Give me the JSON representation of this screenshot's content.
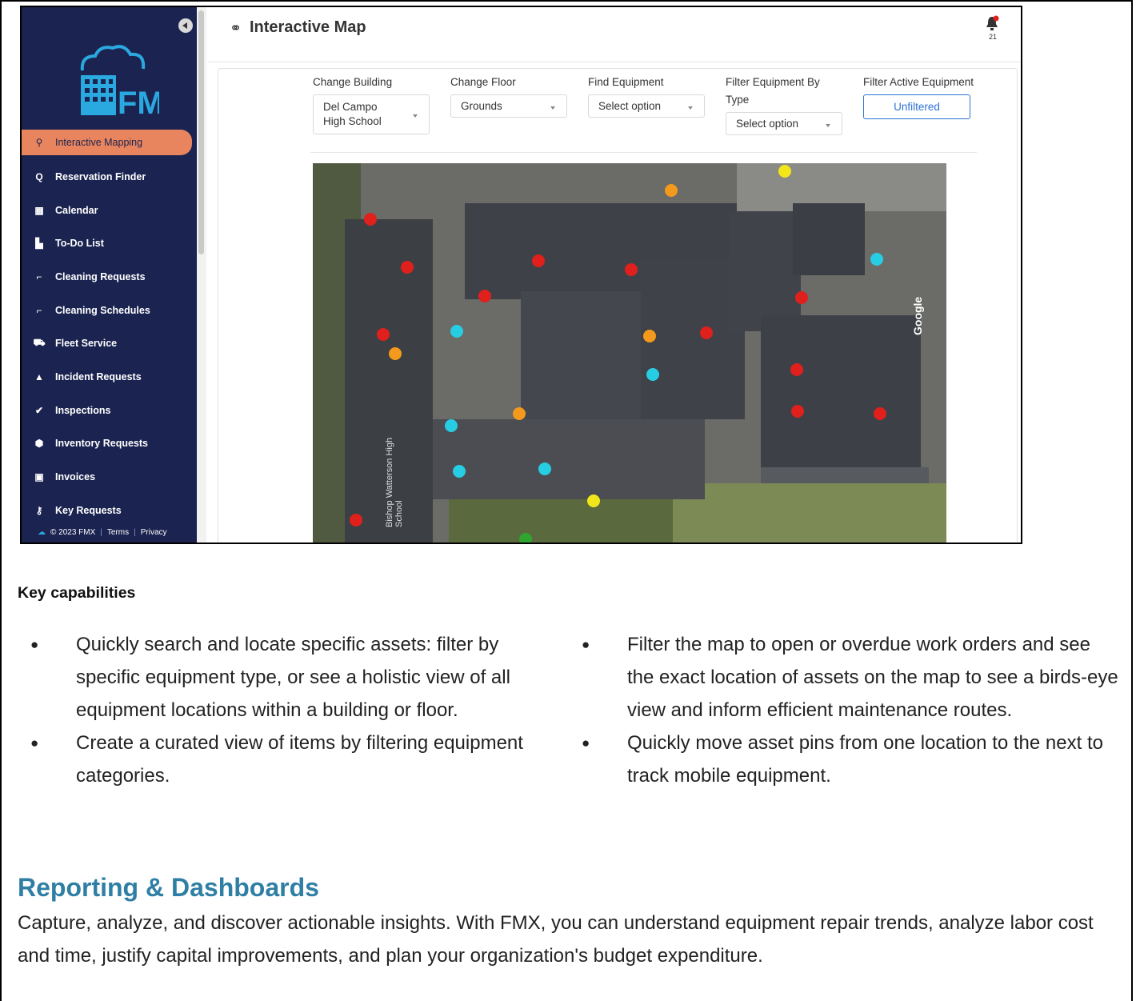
{
  "screenshot": {
    "sidebar": {
      "nav_items": [
        {
          "label": "Interactive Mapping",
          "icon": "map-pin-icon",
          "glyph": "📍"
        },
        {
          "label": "Reservation Finder",
          "icon": "search-icon",
          "glyph": "Q"
        },
        {
          "label": "Calendar",
          "icon": "calendar-icon",
          "glyph": "▦"
        },
        {
          "label": "To-Do List",
          "icon": "clipboard-icon",
          "glyph": "▙"
        },
        {
          "label": "Cleaning Requests",
          "icon": "spray-icon",
          "glyph": "⌐"
        },
        {
          "label": "Cleaning Schedules",
          "icon": "spray-icon",
          "glyph": "⌐"
        },
        {
          "label": "Fleet Service",
          "icon": "car-icon",
          "glyph": "⛟"
        },
        {
          "label": "Incident Requests",
          "icon": "warning-icon",
          "glyph": "▲"
        },
        {
          "label": "Inspections",
          "icon": "check-icon",
          "glyph": "✔"
        },
        {
          "label": "Inventory Requests",
          "icon": "box-icon",
          "glyph": "⬢"
        },
        {
          "label": "Invoices",
          "icon": "money-icon",
          "glyph": "▣"
        },
        {
          "label": "Key Requests",
          "icon": "key-icon",
          "glyph": "⚷"
        }
      ],
      "footer": {
        "copyright": "© 2023 FMX",
        "terms": "Terms",
        "privacy": "Privacy"
      }
    },
    "header": {
      "title": "Interactive Map",
      "notification_count": "21"
    },
    "filters": {
      "building": {
        "label": "Change Building",
        "value": "Del Campo High School"
      },
      "floor": {
        "label": "Change Floor",
        "value": "Grounds"
      },
      "equipment": {
        "label": "Find Equipment",
        "value": "Select option"
      },
      "type": {
        "label": "Filter Equipment By Type",
        "value": "Select option"
      },
      "active": {
        "label": "Filter Active Equipment",
        "value": "Unfiltered"
      }
    },
    "map": {
      "watermark": "Google",
      "street_label": "Bishop Watterson High School",
      "pin_colors": {
        "red": "#e0201c",
        "cyan": "#27cde3",
        "orange": "#f39a1c",
        "yellow": "#f2e61b",
        "green": "#2fa52f"
      }
    }
  },
  "key_capabilities": {
    "title": "Key capabilities",
    "left": [
      "Quickly search and locate specific assets: filter by specific equipment type, or see a holistic view of all equipment locations within a building or floor.",
      "Create a curated view of items by filtering equipment categories."
    ],
    "right": [
      "Filter the map to open or overdue work orders and see the exact location of assets on the map to see a birds-eye view and inform efficient maintenance routes.",
      "Quickly move asset pins from one location to the next to track mobile equipment."
    ]
  },
  "reporting": {
    "title": "Reporting & Dashboards",
    "body": "Capture, analyze, and discover actionable insights. With FMX, you can understand equipment repair trends, analyze labor cost and time, justify capital improvements, and plan your organization's budget expenditure."
  }
}
